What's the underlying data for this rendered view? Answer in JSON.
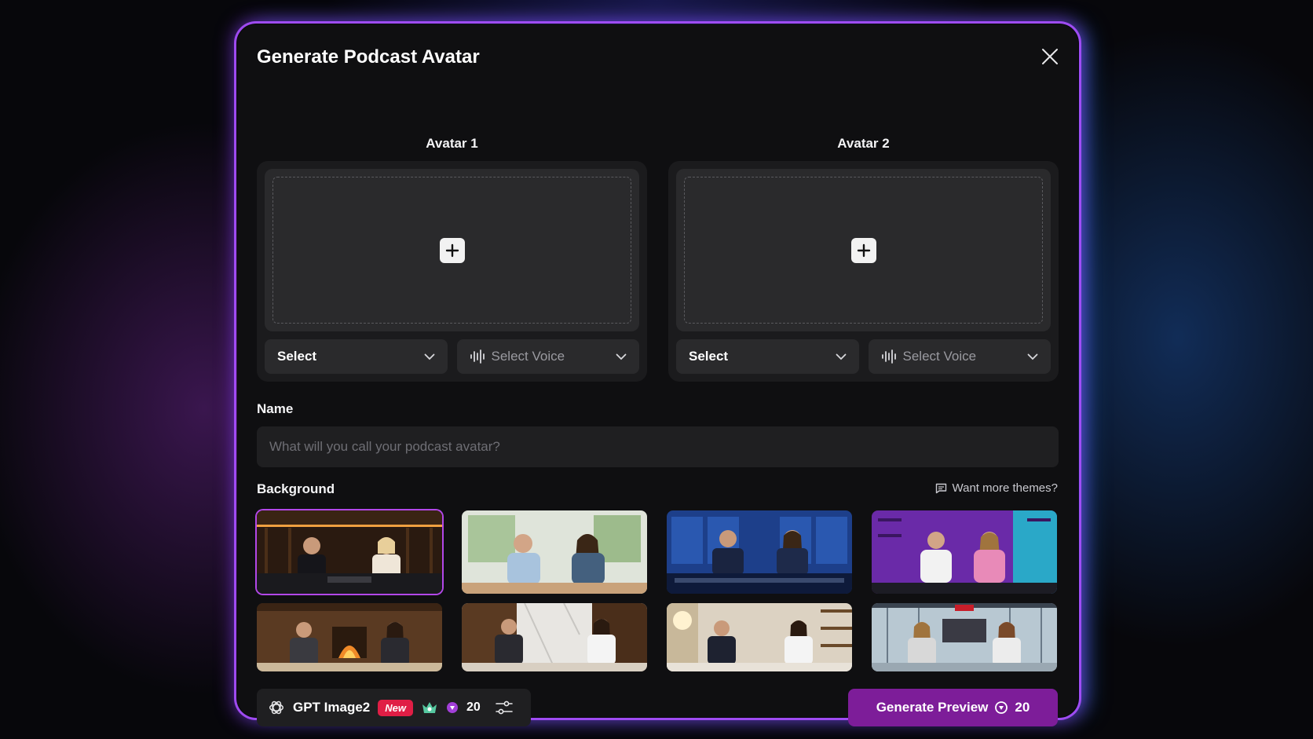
{
  "modal": {
    "title": "Generate Podcast Avatar"
  },
  "avatars": [
    {
      "label": "Avatar 1",
      "select_label": "Select",
      "voice_label": "Select Voice"
    },
    {
      "label": "Avatar 2",
      "select_label": "Select",
      "voice_label": "Select Voice"
    }
  ],
  "name_field": {
    "label": "Name",
    "placeholder": "What will you call your podcast avatar?"
  },
  "background": {
    "label": "Background",
    "more_themes_link": "Want more themes?",
    "selected_index": 0,
    "thumbnails": [
      "Dark studio with wood panels",
      "Bright room with plants",
      "Blue news studio",
      "Neon purple gaming studio",
      "Fireplace lounge",
      "Marble wall studio",
      "Cozy shelf studio",
      "Glass office with screens"
    ]
  },
  "footer": {
    "model_name": "GPT Image2",
    "new_badge": "New",
    "credits": "20",
    "generate_label": "Generate Preview",
    "generate_cost": "20"
  },
  "colors": {
    "accent": "#7d1d99",
    "selected_border": "#b247e8",
    "new_badge": "#e01e45"
  }
}
